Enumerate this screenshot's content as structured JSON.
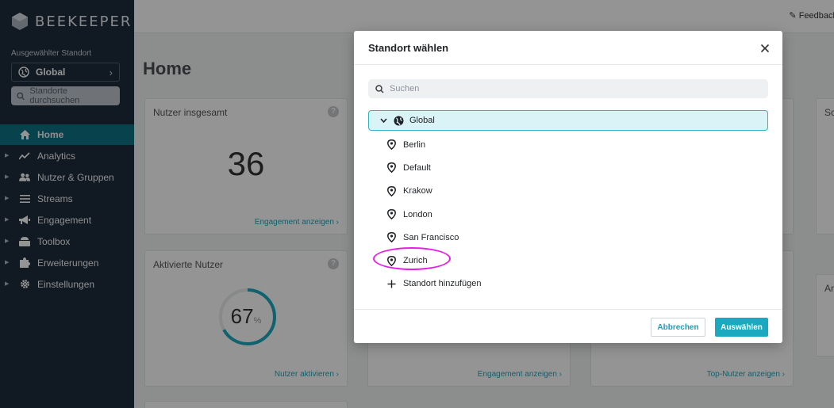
{
  "app": {
    "brand": "BEEKEEPER",
    "feedback": "Feedback"
  },
  "sidebar": {
    "location_label": "Ausgewählter Standort",
    "location_value": "Global",
    "location_search": "Standorte durchsuchen",
    "items": [
      {
        "label": "Home",
        "icon": "home-icon"
      },
      {
        "label": "Analytics",
        "icon": "analytics-icon"
      },
      {
        "label": "Nutzer & Gruppen",
        "icon": "users-icon"
      },
      {
        "label": "Streams",
        "icon": "streams-icon"
      },
      {
        "label": "Engagement",
        "icon": "megaphone-icon"
      },
      {
        "label": "Toolbox",
        "icon": "toolbox-icon"
      },
      {
        "label": "Erweiterungen",
        "icon": "puzzle-icon"
      },
      {
        "label": "Einstellungen",
        "icon": "gear-icon"
      }
    ]
  },
  "main": {
    "title": "Home",
    "cards": {
      "users_total": {
        "title": "Nutzer insgesamt",
        "value": "36",
        "link": "Engagement anzeigen ›"
      },
      "activated": {
        "title": "Aktivierte Nutzer",
        "percent_value": "67",
        "percent_sign": "%",
        "fraction": 0.67,
        "link": "Nutzer aktivieren ›"
      },
      "middle_link": "Engagement anzeigen ›",
      "right_link": "Top-Nutzer anzeigen ›",
      "side_top_title": "Sc",
      "side_bottom_title": "An"
    }
  },
  "modal": {
    "title": "Standort wählen",
    "search_placeholder": "Suchen",
    "root": "Global",
    "locations": [
      "Berlin",
      "Default",
      "Krakow",
      "London",
      "San Francisco",
      "Zurich"
    ],
    "add_label": "Standort hinzufügen",
    "cancel": "Abbrechen",
    "confirm": "Auswählen"
  },
  "colors": {
    "sidebar": "#1e2d3b",
    "active": "#0f7284",
    "accent": "#1aa9be",
    "highlight": "#e81ee8"
  }
}
